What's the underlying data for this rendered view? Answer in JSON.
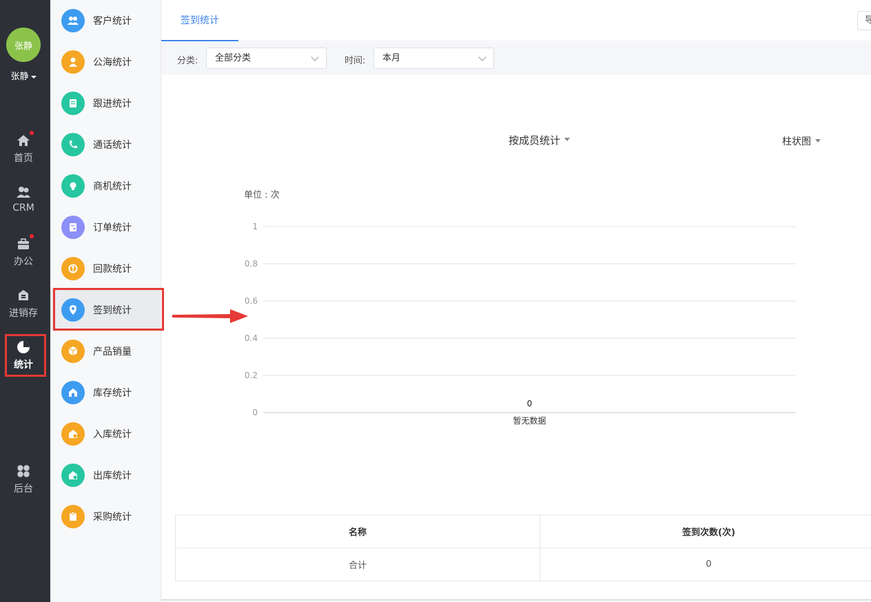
{
  "user": {
    "avatar_text": "张静",
    "name": "张静"
  },
  "nav": {
    "items": [
      {
        "label": "首页",
        "icon": "home-icon",
        "badge": true
      },
      {
        "label": "CRM",
        "icon": "users-icon",
        "badge": false
      },
      {
        "label": "办公",
        "icon": "briefcase-icon",
        "badge": true
      },
      {
        "label": "进销存",
        "icon": "warehouse-icon",
        "badge": false
      },
      {
        "label": "统计",
        "icon": "pie-chart-icon",
        "badge": false,
        "active": true
      },
      {
        "label": "后台",
        "icon": "grid-icon",
        "badge": false
      }
    ]
  },
  "submenu": {
    "items": [
      {
        "label": "客户统计",
        "color": "#3e9cf0"
      },
      {
        "label": "公海统计",
        "color": "#f5a623"
      },
      {
        "label": "跟进统计",
        "color": "#26c6a0"
      },
      {
        "label": "通话统计",
        "color": "#26c6a0"
      },
      {
        "label": "商机统计",
        "color": "#26c6a0"
      },
      {
        "label": "订单统计",
        "color": "#8c8ff7"
      },
      {
        "label": "回款统计",
        "color": "#f5a623"
      },
      {
        "label": "签到统计",
        "color": "#3e9cf0",
        "active": true
      },
      {
        "label": "产品销量",
        "color": "#f5a623"
      },
      {
        "label": "库存统计",
        "color": "#3e9cf0"
      },
      {
        "label": "入库统计",
        "color": "#f5a623"
      },
      {
        "label": "出库统计",
        "color": "#26c6a0"
      },
      {
        "label": "采购统计",
        "color": "#f5a623"
      }
    ]
  },
  "tabs": {
    "active_label": "签到统计",
    "export_label": "导"
  },
  "filters": {
    "category_label": "分类:",
    "category_value": "全部分类",
    "time_label": "时间:",
    "time_value": "本月"
  },
  "chart_controls": {
    "group_by": "按成员统计",
    "chart_type": "柱状图"
  },
  "chart_data": {
    "type": "bar",
    "unit_label": "单位 : 次",
    "categories": [
      "暂无数据"
    ],
    "values": [
      0
    ],
    "ylim": [
      0,
      1
    ],
    "yticks": [
      "1",
      "0.8",
      "0.6",
      "0.4",
      "0.2",
      "0"
    ],
    "grid": true
  },
  "table": {
    "headers": [
      "名称",
      "签到次数(次)"
    ],
    "rows": [
      [
        "合计",
        "0"
      ]
    ]
  }
}
